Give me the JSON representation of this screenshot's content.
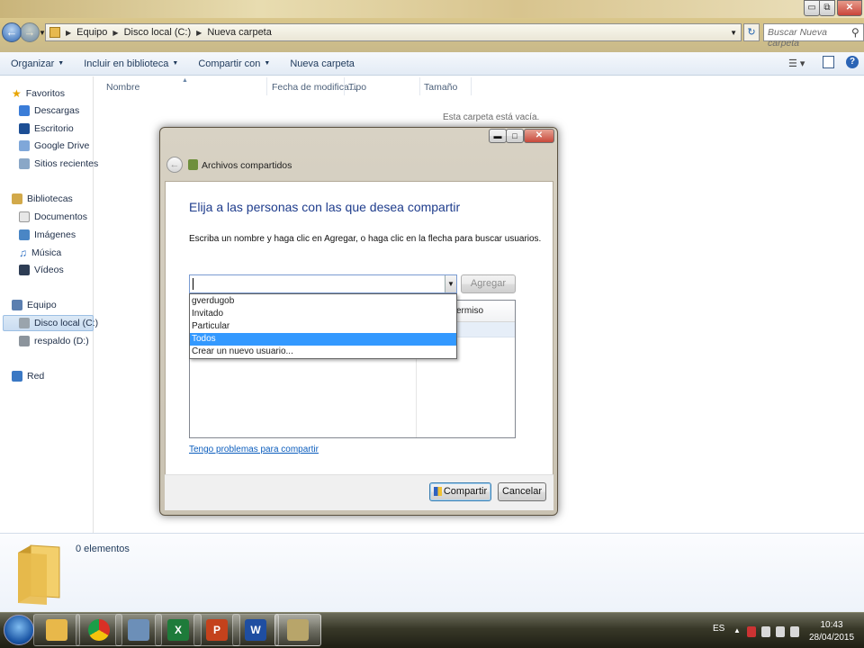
{
  "window": {
    "buttons": [
      "▭",
      "⧉",
      "✕"
    ]
  },
  "address": {
    "crumbs": [
      "Equipo",
      "Disco local (C:)",
      "Nueva carpeta"
    ],
    "search_placeholder": "Buscar Nueva carpeta"
  },
  "toolbar": {
    "organize": "Organizar",
    "include_library": "Incluir en biblioteca",
    "share_with": "Compartir con",
    "new_folder": "Nueva carpeta"
  },
  "nav": {
    "favorites": "Favoritos",
    "downloads": "Descargas",
    "desktop": "Escritorio",
    "google_drive": "Google Drive",
    "recent": "Sitios recientes",
    "libraries": "Bibliotecas",
    "documents": "Documentos",
    "images": "Imágenes",
    "music": "Música",
    "videos": "Vídeos",
    "computer": "Equipo",
    "local_disk": "Disco local (C:)",
    "backup": "respaldo (D:)",
    "network": "Red"
  },
  "columns": {
    "name": "Nombre",
    "date": "Fecha de modifica...",
    "type": "Tipo",
    "size": "Tamaño"
  },
  "empty_message": "Esta carpeta está vacía.",
  "details": {
    "count": "0 elementos"
  },
  "dialog": {
    "title": "Archivos compartidos",
    "heading": "Elija a las personas con las que desea compartir",
    "instruction": "Escriba un nombre y haga clic en Agregar, o haga clic en la flecha para buscar usuarios.",
    "add_button": "Agregar",
    "dropdown_items": [
      "gverdugob",
      "Invitado",
      "Particular",
      "Todos",
      "Crear un nuevo usuario..."
    ],
    "selected_item": "Todos",
    "permission_header": "ermiso",
    "help_link": "Tengo problemas para compartir",
    "share_button": "Compartir",
    "cancel_button": "Cancelar"
  },
  "taskbar": {
    "language": "ES",
    "time": "10:43",
    "date": "28/04/2015"
  }
}
